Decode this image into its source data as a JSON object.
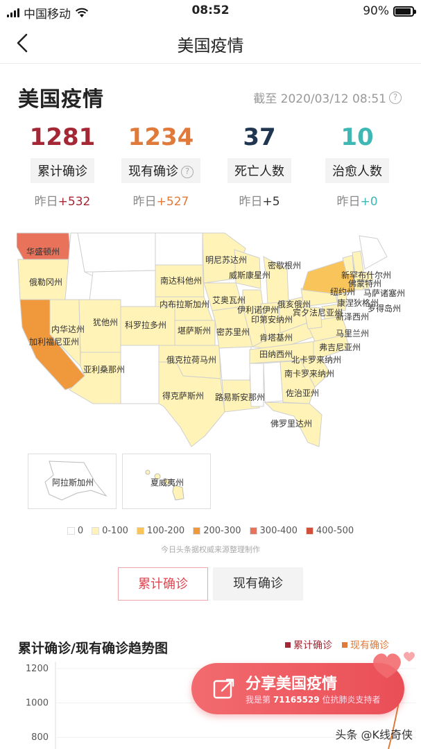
{
  "status_bar": {
    "carrier": "中国移动",
    "time": "08:52",
    "battery": "90%",
    "battery_level": 0.9
  },
  "nav": {
    "title": "美国疫情"
  },
  "header": {
    "title": "美国疫情",
    "as_of": "截至 2020/03/12 08:51"
  },
  "stats": [
    {
      "value": "1281",
      "label": "累计确诊",
      "delta_prefix": "昨日",
      "delta": "+532",
      "color": "#a32734",
      "delta_color": "#a32734",
      "help": false
    },
    {
      "value": "1234",
      "label": "现有确诊",
      "delta_prefix": "昨日",
      "delta": "+527",
      "color": "#e07a3a",
      "delta_color": "#e07a3a",
      "help": true
    },
    {
      "value": "37",
      "label": "死亡人数",
      "delta_prefix": "昨日",
      "delta": "+5",
      "color": "#1f3550",
      "delta_color": "#333333",
      "help": false
    },
    {
      "value": "10",
      "label": "治愈人数",
      "delta_prefix": "昨日",
      "delta": "+0",
      "color": "#3fb7b5",
      "delta_color": "#3fb7b5",
      "help": false
    }
  ],
  "map": {
    "states": {
      "washington": "华盛顿州",
      "oregon": "俄勒冈州",
      "california": "加利福尼亚州",
      "nevada": "内华达州",
      "utah": "犹他州",
      "arizona": "亚利桑那州",
      "colorado": "科罗拉多州",
      "south_dakota": "南达科他州",
      "nebraska": "内布拉斯加州",
      "kansas": "堪萨斯州",
      "oklahoma": "俄克拉荷马州",
      "texas": "得克萨斯州",
      "minnesota": "明尼苏达州",
      "wisconsin": "威斯康星州",
      "iowa": "艾奥瓦州",
      "illinois": "伊利诺伊州",
      "missouri": "密苏里州",
      "louisiana": "路易斯安那州",
      "michigan": "密歇根州",
      "indiana": "印第安纳州",
      "ohio": "俄亥俄州",
      "kentucky": "肯塔基州",
      "tennessee": "田纳西州",
      "georgia": "佐治亚州",
      "florida": "佛罗里达州",
      "south_carolina": "南卡罗来纳州",
      "north_carolina": "北卡罗来纳州",
      "virginia": "弗吉尼亚州",
      "pennsylvania": "宾夕法尼亚州",
      "new_york": "纽约州",
      "new_jersey": "新泽西州",
      "maryland": "马里兰州",
      "new_hampshire": "新罕布什尔州",
      "vermont": "佛蒙特州",
      "massachusetts": "马萨诸塞州",
      "connecticut": "康涅狄格州",
      "rhode_island": "罗得岛州"
    },
    "insets": {
      "alaska": "阿拉斯加州",
      "hawaii": "夏威夷州"
    },
    "legend": [
      {
        "label": "0",
        "color": "#ffffff"
      },
      {
        "label": "0-100",
        "color": "#fff3b8"
      },
      {
        "label": "100-200",
        "color": "#f9c55a"
      },
      {
        "label": "200-300",
        "color": "#f0993c"
      },
      {
        "label": "300-400",
        "color": "#e9725a"
      },
      {
        "label": "400-500",
        "color": "#d2503a"
      }
    ],
    "source": "今日头条据权威来源整理制作"
  },
  "toggles": {
    "active": "累计确诊",
    "inactive": "现有确诊"
  },
  "trend": {
    "title": "累计确诊/现有确诊趋势图",
    "legend": [
      {
        "label": "累计确诊",
        "color": "#a32734"
      },
      {
        "label": "现有确诊",
        "color": "#e07a3a"
      }
    ]
  },
  "chart_data": {
    "type": "line",
    "title": "累计确诊/现有确诊趋势图",
    "y_ticks": [
      "1200",
      "1000",
      "800"
    ],
    "ylim": [
      700,
      1200
    ],
    "series": [
      {
        "name": "累计确诊",
        "values": []
      },
      {
        "name": "现有确诊",
        "values": []
      }
    ]
  },
  "share": {
    "title": "分享美国疫情",
    "sub_prefix": "我是第 ",
    "sub_number": "71165529",
    "sub_suffix": " 位抗肺炎支持者"
  },
  "watermark": "头条 @K线奇侠"
}
